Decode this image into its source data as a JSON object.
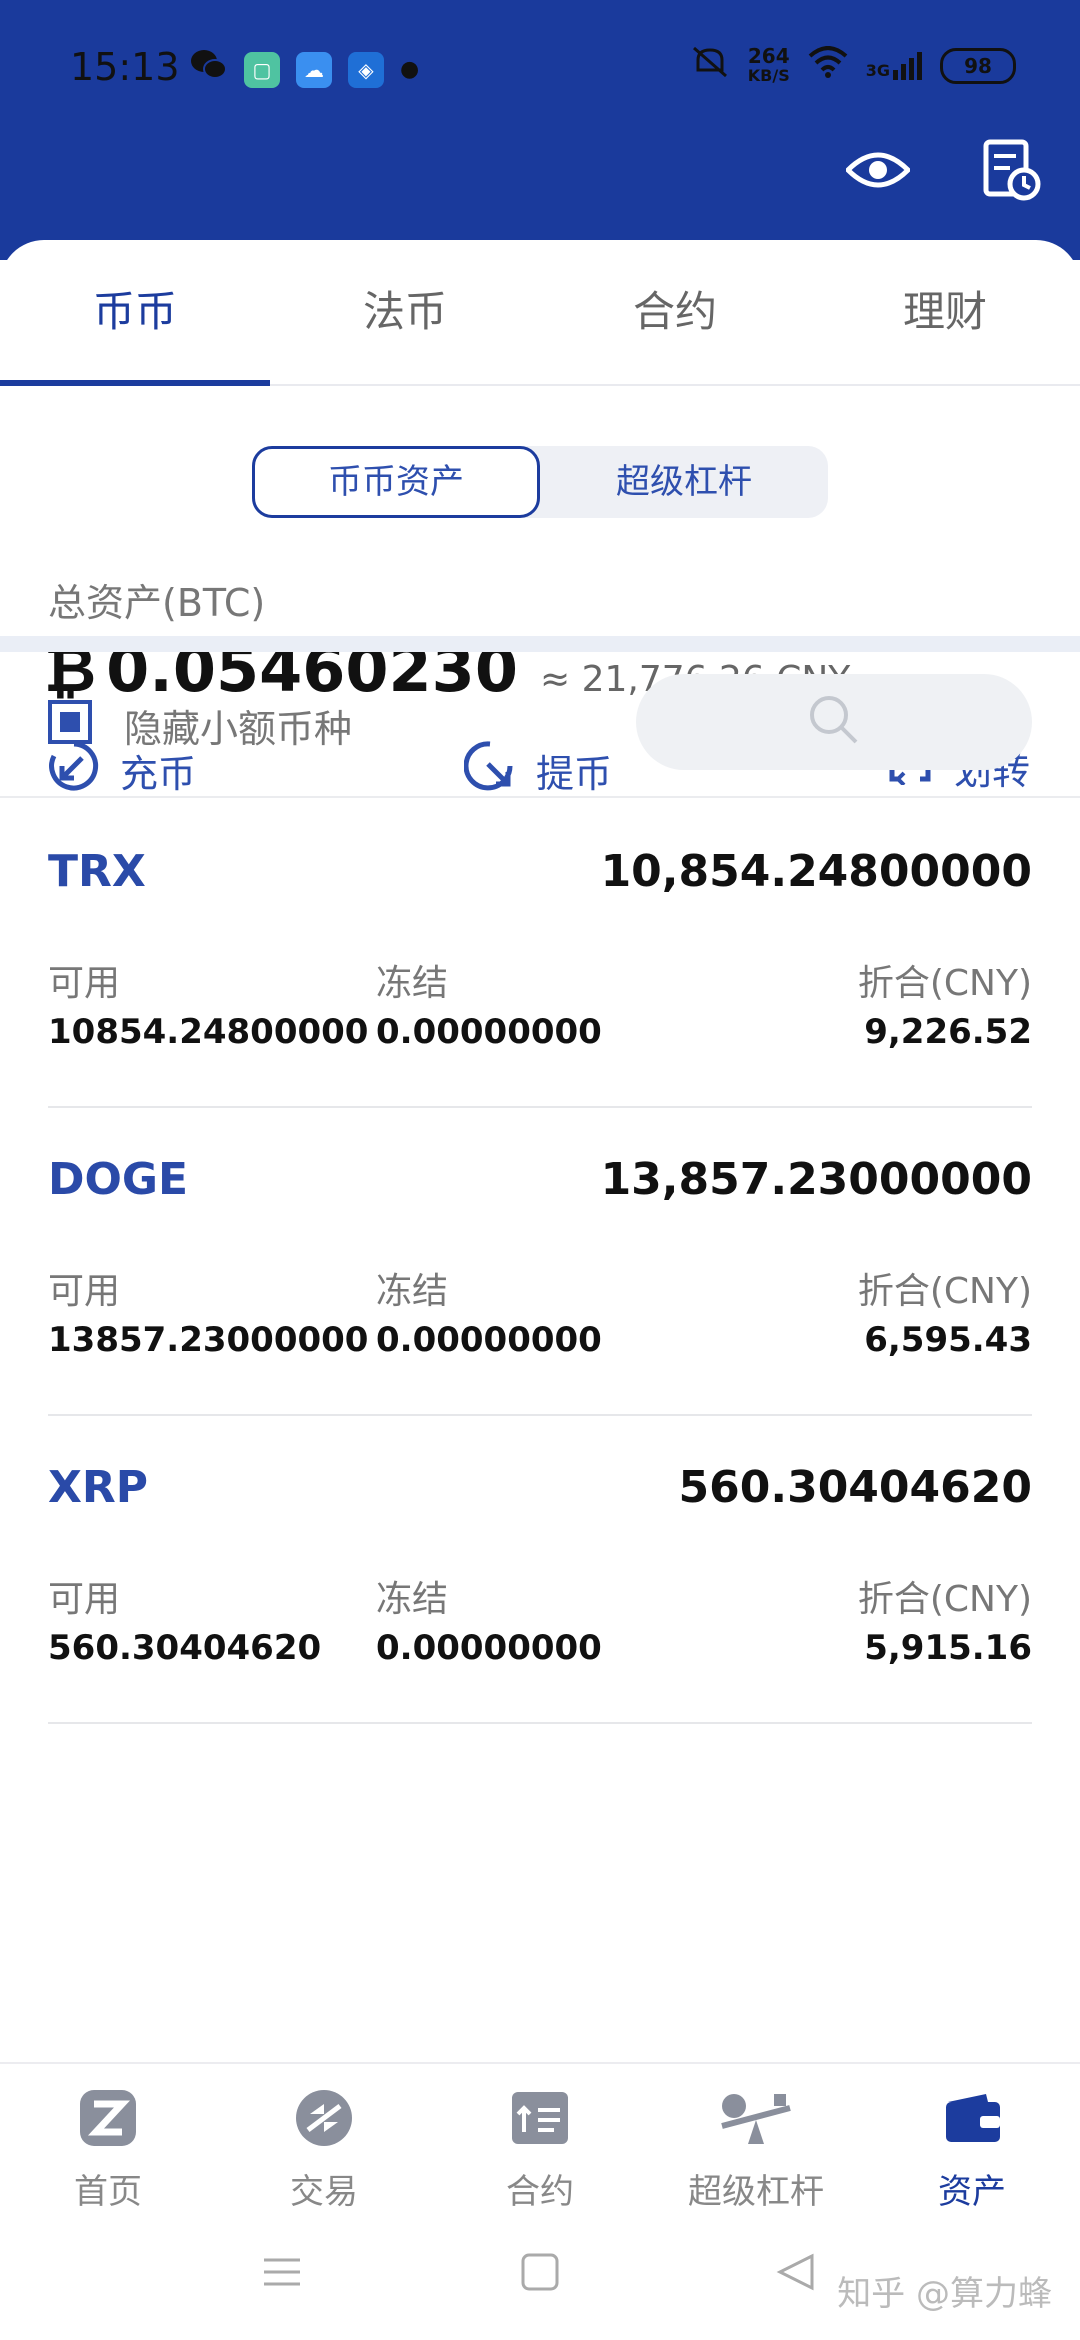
{
  "status_bar": {
    "time": "15:13",
    "net_speed": "264",
    "net_unit": "KB/S",
    "signal": "3G",
    "battery": "98"
  },
  "tabs": [
    {
      "label": "币币",
      "active": true
    },
    {
      "label": "法币",
      "active": false
    },
    {
      "label": "合约",
      "active": false
    },
    {
      "label": "理财",
      "active": false
    }
  ],
  "segments": {
    "s1": "币币资产",
    "s2": "超级杠杆"
  },
  "total": {
    "label": "总资产(BTC)",
    "symbol": "₿",
    "value": "0.05460230",
    "cny": "≈ 21,776.26 CNY"
  },
  "actions": {
    "deposit": "充币",
    "withdraw": "提币",
    "transfer": "划转"
  },
  "filter": {
    "hide_small_label": "隐藏小额币种",
    "hide_small_checked": true
  },
  "labels": {
    "available": "可用",
    "frozen": "冻结",
    "cny_value": "折合(CNY)"
  },
  "assets": [
    {
      "name": "TRX",
      "amount": "10,854.24800000",
      "available": "10854.24800000",
      "frozen": "0.00000000",
      "cny": "9,226.52"
    },
    {
      "name": "DOGE",
      "amount": "13,857.23000000",
      "available": "13857.23000000",
      "frozen": "0.00000000",
      "cny": "6,595.43"
    },
    {
      "name": "XRP",
      "amount": "560.30404620",
      "available": "560.30404620",
      "frozen": "0.00000000",
      "cny": "5,915.16"
    }
  ],
  "bottom_nav": [
    {
      "label": "首页",
      "icon": "z-logo-icon"
    },
    {
      "label": "交易",
      "icon": "trade-icon"
    },
    {
      "label": "合约",
      "icon": "contract-icon"
    },
    {
      "label": "超级杠杆",
      "icon": "seesaw-icon"
    },
    {
      "label": "资产",
      "icon": "wallet-icon",
      "active": true
    }
  ],
  "watermark": "知乎 @算力蜂",
  "colors": {
    "header": "#1a3a9c",
    "accent": "#1c3c9e"
  }
}
